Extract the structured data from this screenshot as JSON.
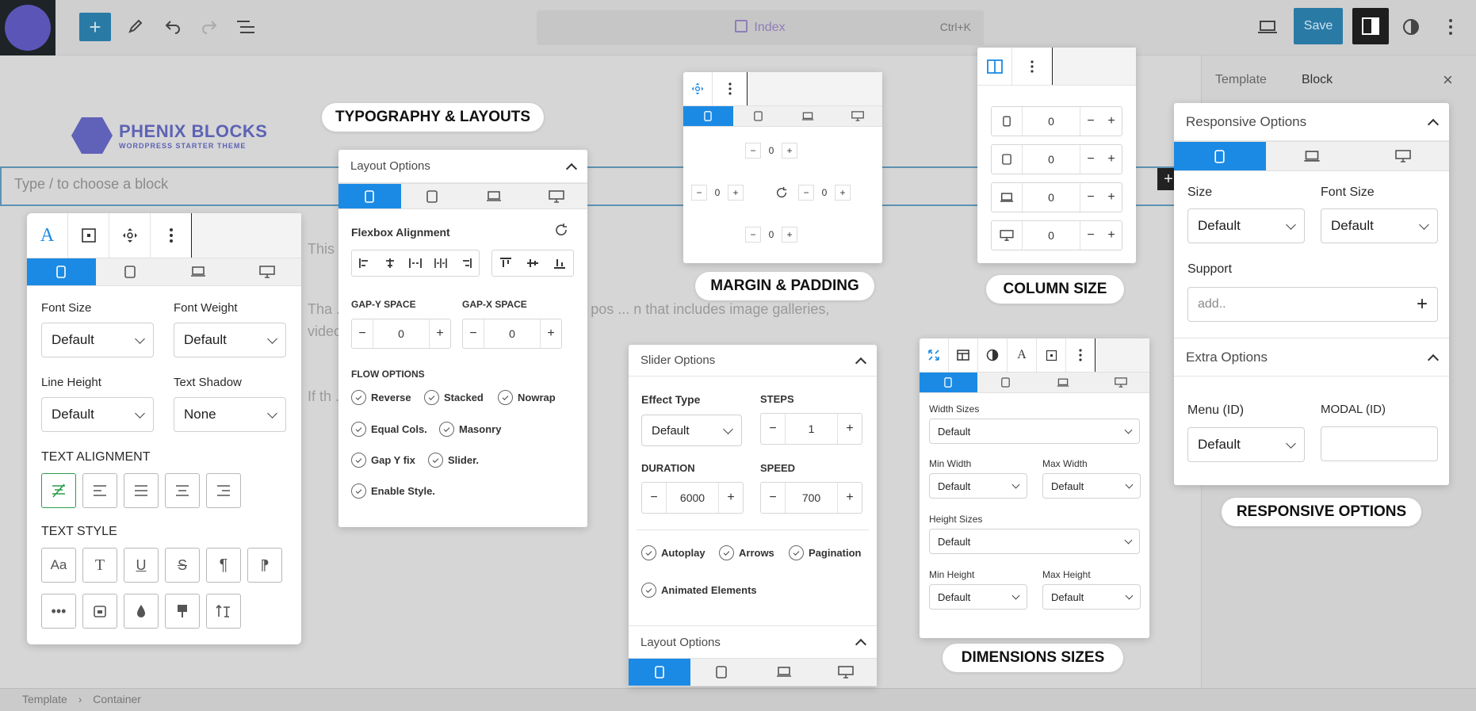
{
  "editor": {
    "doc_title": "Index",
    "shortcut": "Ctrl+K",
    "save_label": "Save",
    "sidebar_tabs": [
      "Template",
      "Block"
    ],
    "logo_text": "PHENIX BLOCKS",
    "logo_sub": "WORDPRESS STARTER THEME",
    "block_placeholder": "Type / to choose a block",
    "breadcrumb": [
      "Template",
      "Container"
    ],
    "bg_paragraphs": [
      "This ... y all the bloc ... or p",
      "Tha ... like consecutive paragraphs in a blog pos ... n that includes image galleries, videos, tabl ... types",
      "If th ... egiste ... bloc ... se en"
    ]
  },
  "labels": {
    "typography": "TYPOGRAPHY & LAYOUTS",
    "margin": "MARGIN & PADDING",
    "column": "COLUMN SIZE",
    "responsive": "RESPONSIVE OPTIONS",
    "dimensions": "DIMENSIONS SIZES"
  },
  "typo_panel": {
    "font_size_label": "Font Size",
    "font_size_value": "Default",
    "font_weight_label": "Font Weight",
    "font_weight_value": "Default",
    "line_height_label": "Line Height",
    "line_height_value": "Default",
    "text_shadow_label": "Text Shadow",
    "text_shadow_value": "None",
    "text_alignment_label": "TEXT ALIGNMENT",
    "text_style_label": "TEXT STYLE",
    "text_style_glyph": "Aa"
  },
  "layout_panel": {
    "title": "Layout Options",
    "flexbox_label": "Flexbox Alignment",
    "gap_y_label": "GAP-Y SPACE",
    "gap_y_value": "0",
    "gap_x_label": "GAP-X SPACE",
    "gap_x_value": "0",
    "flow_label": "FLOW OPTIONS",
    "flow_options": [
      "Reverse",
      "Stacked",
      "Nowrap",
      "Equal Cols.",
      "Masonry",
      "Gap Y fix",
      "Slider.",
      "Enable Style."
    ]
  },
  "margin_panel": {
    "top": "0",
    "left": "0",
    "right": "0",
    "bottom": "0"
  },
  "column_panel": {
    "rows": [
      "0",
      "0",
      "0",
      "0"
    ]
  },
  "slider_panel": {
    "title": "Slider Options",
    "effect_label": "Effect Type",
    "effect_value": "Default",
    "steps_label": "STEPS",
    "steps_value": "1",
    "duration_label": "DURATION",
    "duration_value": "6000",
    "speed_label": "SPEED",
    "speed_value": "700",
    "checks": [
      "Autoplay",
      "Arrows",
      "Pagination",
      "Animated Elements"
    ],
    "layout_title": "Layout Options"
  },
  "dimensions_panel": {
    "width_sizes_label": "Width Sizes",
    "width_sizes_value": "Default",
    "min_width_label": "Min Width",
    "min_width_value": "Default",
    "max_width_label": "Max Width",
    "max_width_value": "Default",
    "height_sizes_label": "Height Sizes",
    "height_sizes_value": "Default",
    "min_height_label": "Min Height",
    "min_height_value": "Default",
    "max_height_label": "Max Height",
    "max_height_value": "Default"
  },
  "responsive_panel": {
    "title": "Responsive Options",
    "size_label": "Size",
    "size_value": "Default",
    "font_size_label": "Font Size",
    "font_size_value": "Default",
    "support_label": "Support",
    "support_placeholder": "add..",
    "extra_title": "Extra Options",
    "menu_label": "Menu (ID)",
    "menu_value": "Default",
    "modal_label": "MODAL (ID)",
    "modal_value": ""
  },
  "colors": {
    "accent": "#1b8ae4",
    "wp_blue": "#2a7aa6",
    "active_align": "#2a9d4a"
  }
}
